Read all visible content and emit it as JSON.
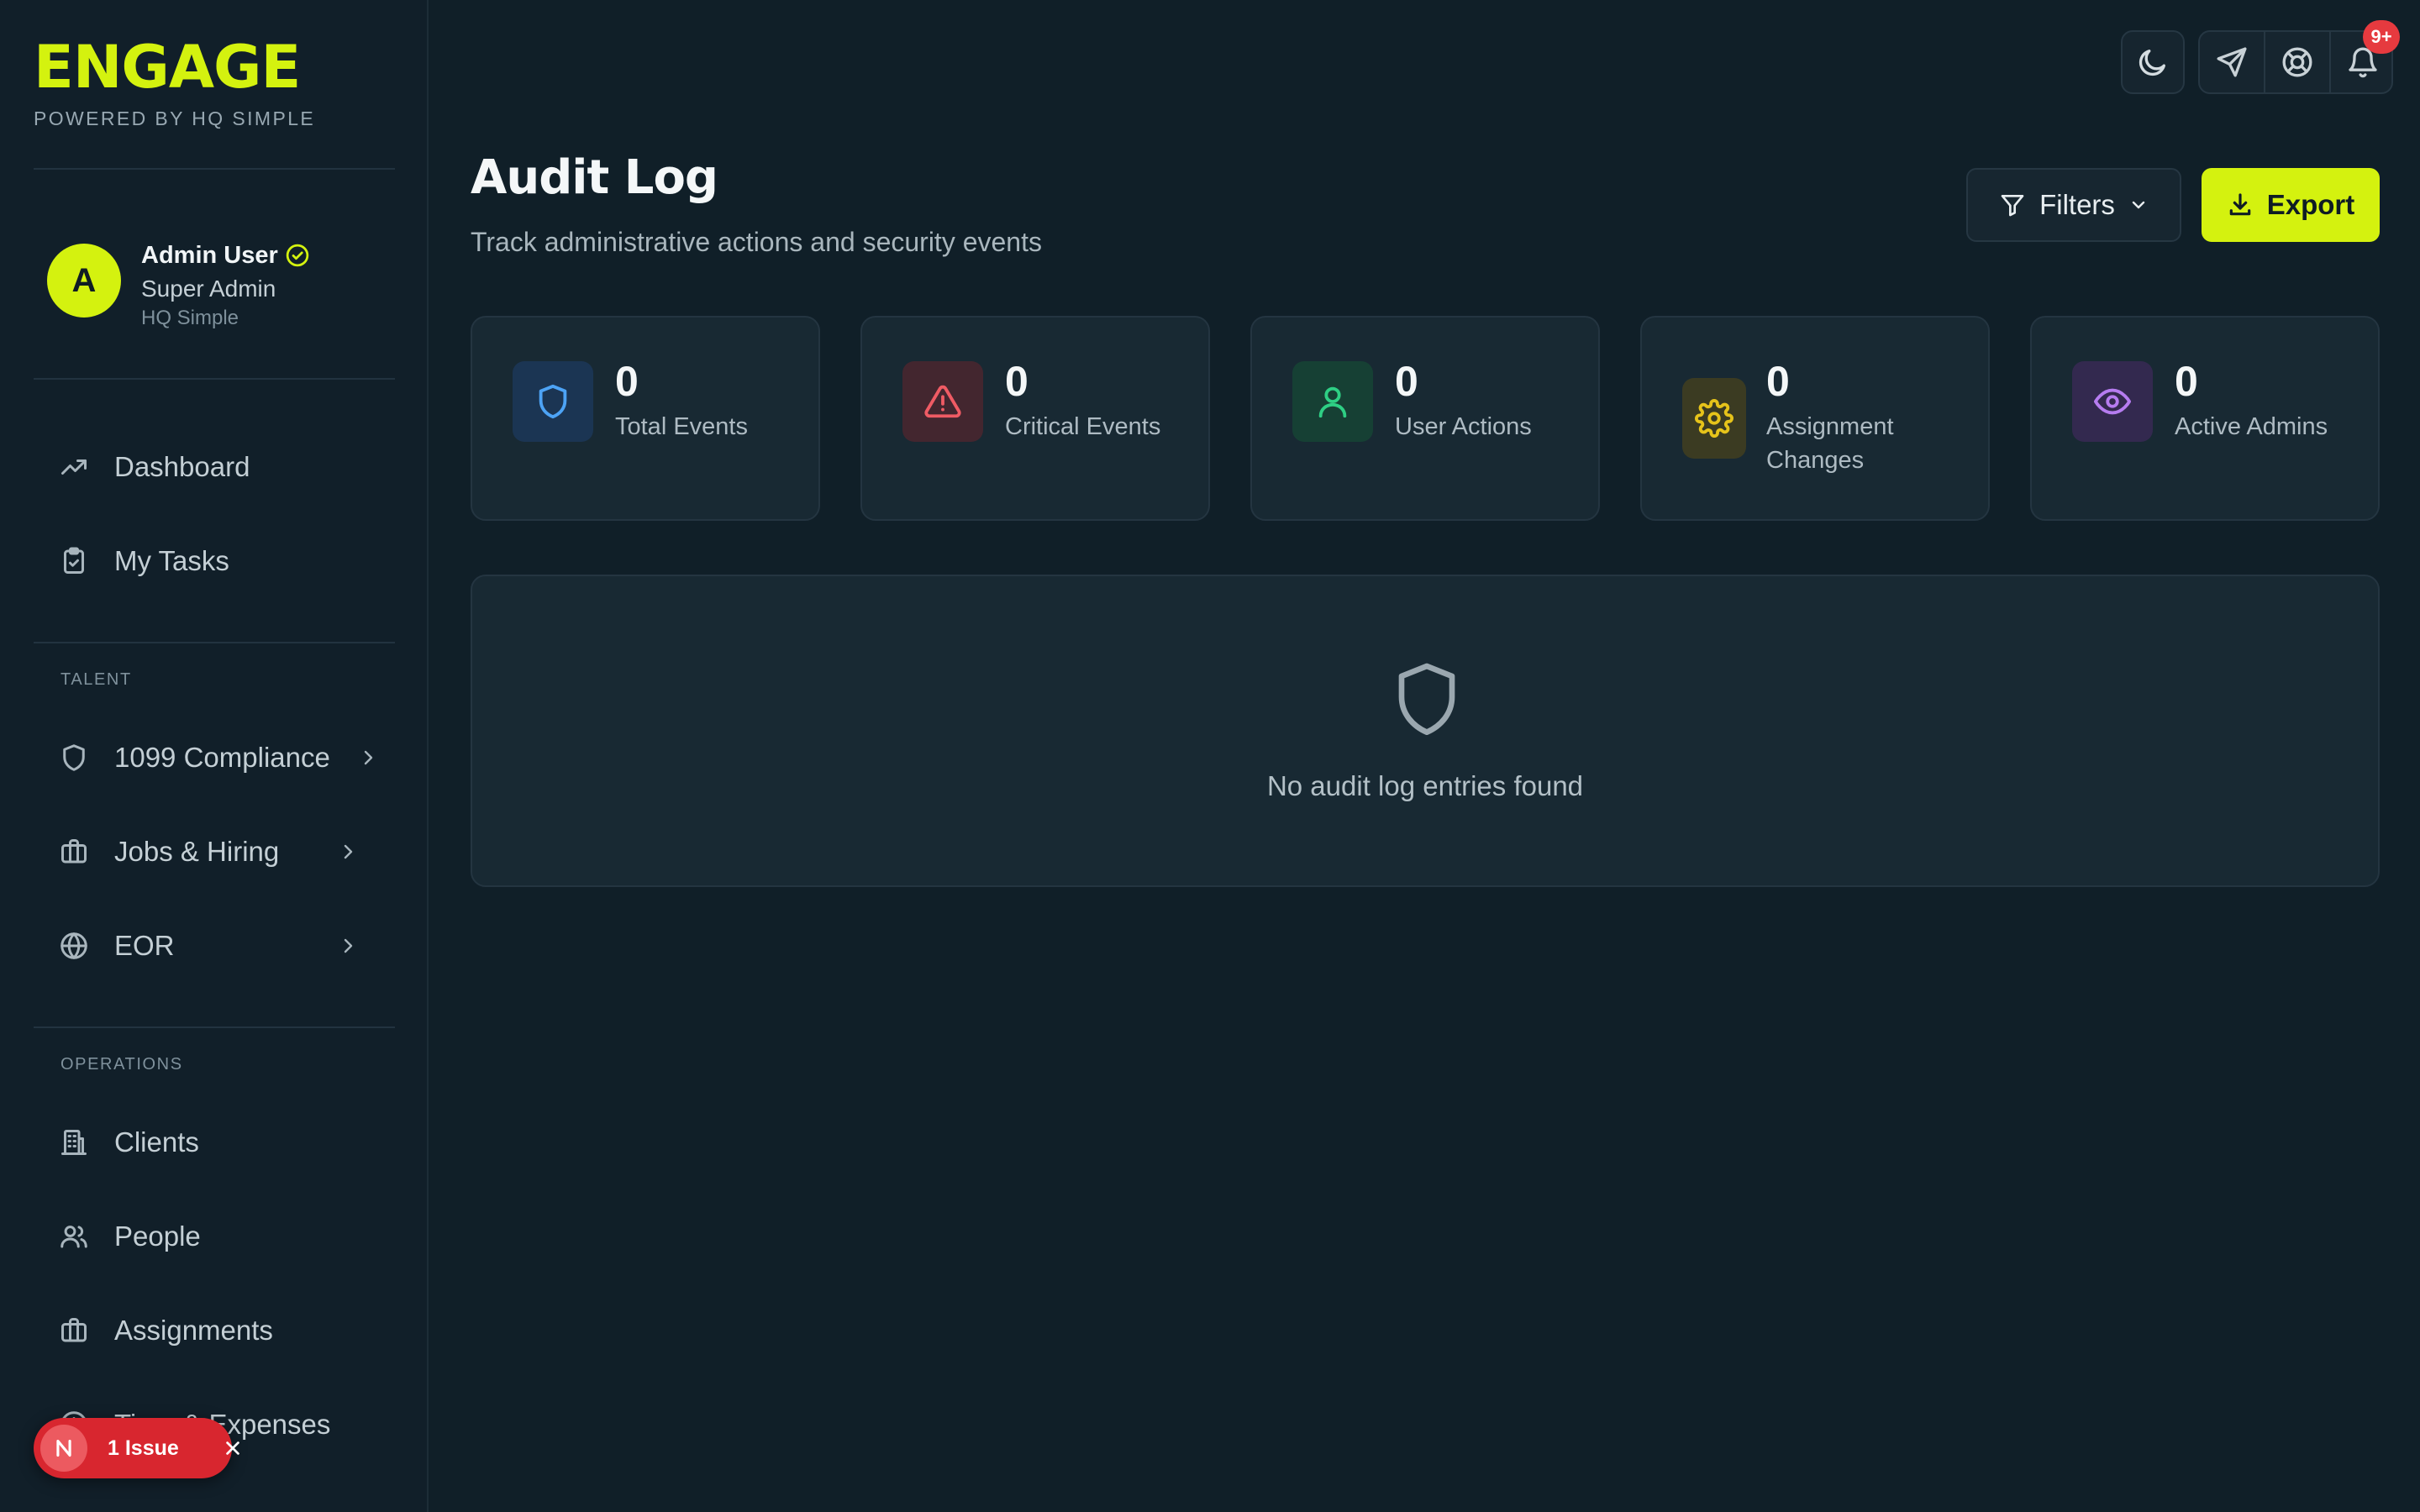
{
  "brand": {
    "name": "ENGAGE",
    "tagline": "POWERED BY HQ SIMPLE",
    "accent": "#d4f20f"
  },
  "user": {
    "initial": "A",
    "name": "Admin User",
    "role": "Super Admin",
    "org": "HQ Simple"
  },
  "sidebar": {
    "top_items": [
      {
        "label": "Dashboard",
        "icon": "trending-up-icon"
      },
      {
        "label": "My Tasks",
        "icon": "clipboard-check-icon"
      }
    ],
    "sections": [
      {
        "label": "TALENT",
        "items": [
          {
            "label": "1099 Compliance",
            "icon": "shield-icon",
            "expandable": true
          },
          {
            "label": "Jobs & Hiring",
            "icon": "briefcase-icon",
            "expandable": true
          },
          {
            "label": "EOR",
            "icon": "globe-icon",
            "expandable": true
          }
        ]
      },
      {
        "label": "OPERATIONS",
        "items": [
          {
            "label": "Clients",
            "icon": "building-icon"
          },
          {
            "label": "People",
            "icon": "users-icon"
          },
          {
            "label": "Assignments",
            "icon": "briefcase-icon"
          },
          {
            "label": "Time & Expenses",
            "icon": "clock-icon"
          }
        ]
      }
    ]
  },
  "topbar": {
    "theme_icon": "moon-icon",
    "actions": [
      "send-icon",
      "lifebuoy-icon",
      "bell-icon"
    ],
    "notification_badge": "9+"
  },
  "page": {
    "title": "Audit Log",
    "subtitle": "Track administrative actions and security events",
    "filters_label": "Filters",
    "export_label": "Export"
  },
  "stats": [
    {
      "value": "0",
      "label": "Total Events",
      "icon": "shield-icon",
      "bg": "#1b3553",
      "color": "#4da3f5"
    },
    {
      "value": "0",
      "label": "Critical Events",
      "icon": "alert-triangle-icon",
      "bg": "#43262f",
      "color": "#ef5b64"
    },
    {
      "value": "0",
      "label": "User Actions",
      "icon": "user-icon",
      "bg": "#164034",
      "color": "#2ecf84"
    },
    {
      "value": "0",
      "label": "Assignment Changes",
      "icon": "settings-icon",
      "bg": "#3b3b22",
      "color": "#e6c31a"
    },
    {
      "value": "0",
      "label": "Active Admins",
      "icon": "eye-icon",
      "bg": "#33294f",
      "color": "#b67cf0"
    }
  ],
  "empty_state": {
    "message": "No audit log entries found",
    "icon": "shield-icon"
  },
  "dev_overlay": {
    "badge_letter": "N",
    "label": "1 Issue"
  }
}
